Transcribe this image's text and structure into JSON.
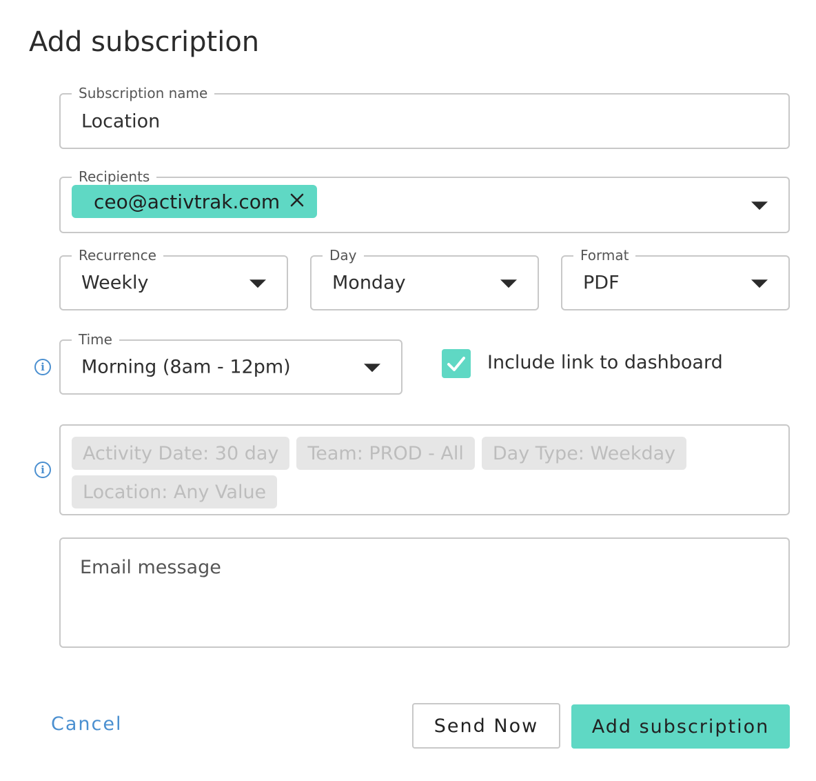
{
  "dialog": {
    "title": "Add subscription"
  },
  "subscription_name": {
    "label": "Subscription name",
    "value": "Location"
  },
  "recipients": {
    "label": "Recipients",
    "chips": [
      "ceo@activtrak.com"
    ]
  },
  "recurrence": {
    "label": "Recurrence",
    "value": "Weekly"
  },
  "day": {
    "label": "Day",
    "value": "Monday"
  },
  "format": {
    "label": "Format",
    "value": "PDF"
  },
  "time": {
    "label": "Time",
    "value": "Morning (8am - 12pm)"
  },
  "include_link": {
    "label": "Include link to dashboard",
    "checked": true
  },
  "filters": [
    "Activity Date: 30 day",
    "Team: PROD - All",
    "Day Type: Weekday",
    "Location: Any Value"
  ],
  "email_message": {
    "placeholder": "Email message"
  },
  "actions": {
    "cancel": "Cancel",
    "send_now": "Send Now",
    "add": "Add subscription"
  },
  "colors": {
    "accent": "#5fd8c4",
    "link": "#4a8fd0",
    "border": "#c8c8c8",
    "chip_disabled_bg": "#e6e6e6"
  }
}
